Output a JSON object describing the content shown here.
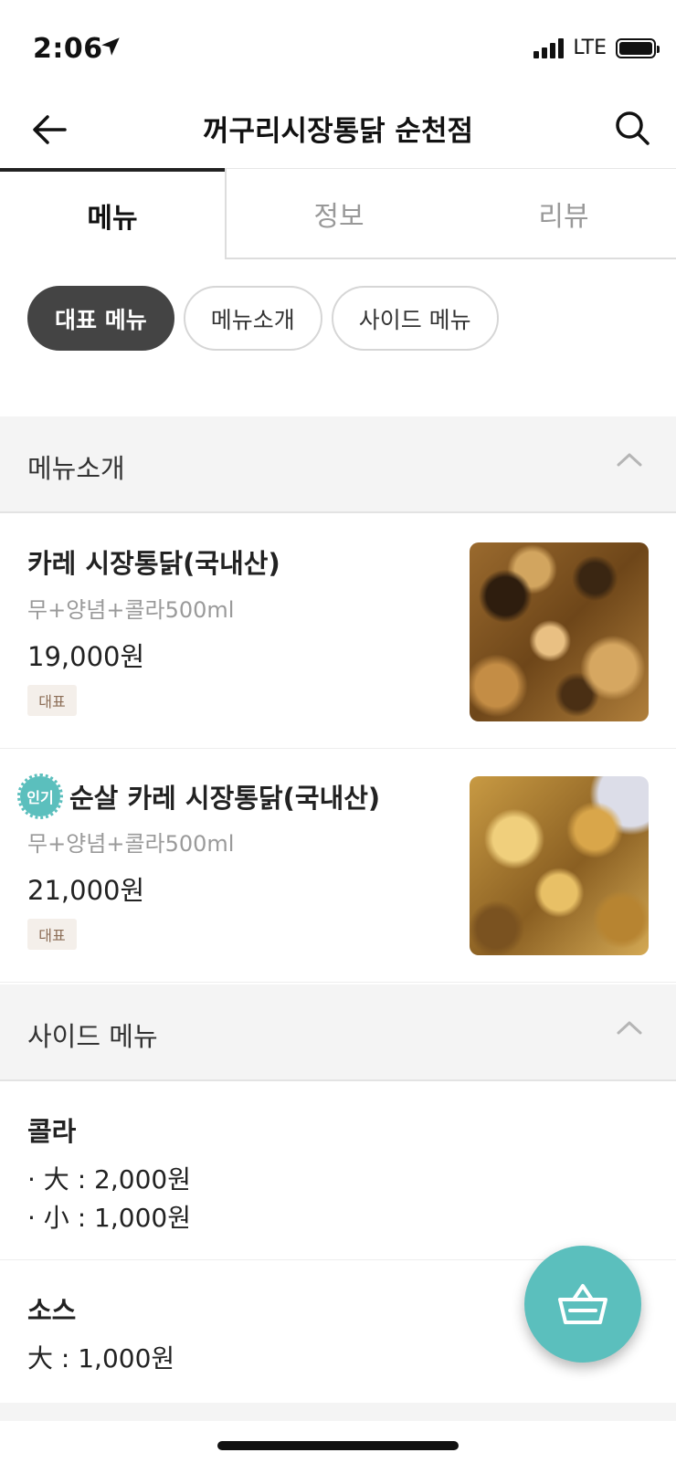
{
  "status_bar": {
    "time": "2:06",
    "network": "LTE"
  },
  "header": {
    "title": "꺼구리시장통닭 순천점"
  },
  "tabs": [
    {
      "label": "메뉴",
      "active": true
    },
    {
      "label": "정보",
      "active": false
    },
    {
      "label": "리뷰",
      "active": false
    }
  ],
  "chips": [
    {
      "label": "대표 메뉴",
      "selected": true
    },
    {
      "label": "메뉴소개",
      "selected": false
    },
    {
      "label": "사이드 메뉴",
      "selected": false
    }
  ],
  "sections": {
    "menu_intro": {
      "title": "메뉴소개"
    },
    "side_menu": {
      "title": "사이드 메뉴"
    }
  },
  "menu_items": [
    {
      "name": "카레 시장통닭(국내산)",
      "desc": "무+양념+콜라500ml",
      "price": "19,000원",
      "tag": "대표",
      "badge": ""
    },
    {
      "name": "순살 카레 시장통닭(국내산)",
      "desc": "무+양념+콜라500ml",
      "price": "21,000원",
      "tag": "대표",
      "badge": "인기"
    }
  ],
  "side_items": [
    {
      "name": "콜라",
      "lines": [
        "· 大 : 2,000원",
        "· 小 : 1,000원"
      ]
    },
    {
      "name": "소스",
      "lines": [
        "大 : 1,000원"
      ]
    }
  ],
  "colors": {
    "accent": "#5bbfbd",
    "chip_selected": "#444444",
    "tag_bg": "#f4efea",
    "tag_text": "#8c6e57"
  },
  "icons": {
    "back": "arrow-left-icon",
    "search": "search-icon",
    "collapse": "chevron-up-icon",
    "cart": "basket-icon",
    "location": "location-arrow-icon"
  }
}
